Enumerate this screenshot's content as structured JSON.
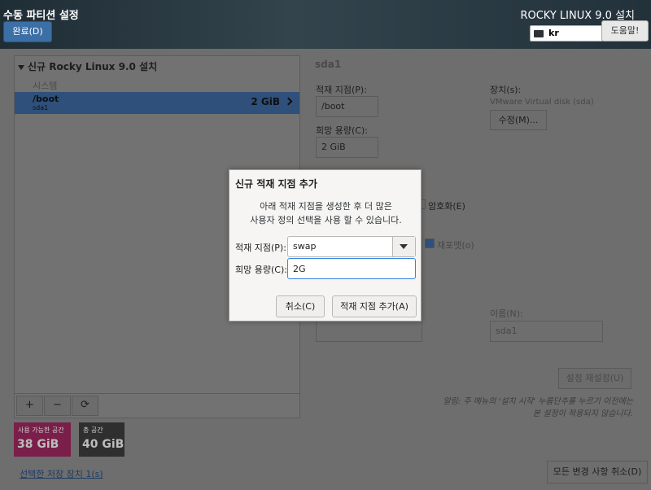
{
  "header": {
    "title": "수동 파티션 설정",
    "done_label": "완료(D)",
    "product_title": "ROCKY LINUX 9.0 설치",
    "keyboard_layout": "kr",
    "help_label": "도움말!"
  },
  "left_panel": {
    "install_title": "신규 Rocky Linux 9.0 설치",
    "system_label": "시스템",
    "selected_mount": {
      "name": "/boot",
      "device": "sda1",
      "size": "2 GiB"
    },
    "toolbar": {
      "add": "+",
      "remove": "−",
      "refresh": "⟳"
    }
  },
  "space": {
    "available_label": "사용 가능한 공간",
    "available_value": "38 GiB",
    "total_label": "총 공간",
    "total_value": "40 GiB"
  },
  "storage_link": "선택한 저장 장치 1(s)",
  "details": {
    "title": "sda1",
    "mount_point_label": "적재 지점(P):",
    "mount_point_value": "/boot",
    "capacity_label": "희망 용량(C):",
    "capacity_value": "2 GiB",
    "device_label": "장치(s):",
    "device_value": "VMware Virtual disk (sda)",
    "modify_label": "수정(M)...",
    "encrypt_label": "암호화(E)",
    "reformat_label": "재포맷(o)",
    "name_label": "이름(N):",
    "name_value": "sda1",
    "reset_label": "설정 재설정(U)",
    "note_line1": "알림: 주 메뉴의 '설치 시작' 누름단추를 누르기 이전에는",
    "note_line2": "본 설정이 적용되지 않습니다.",
    "discard_label": "모든 변경 사항 취소(D)"
  },
  "dialog": {
    "title": "신규 적재 지점 추가",
    "desc_line1": "아래 적재 지점을 생성한 후 더 많은",
    "desc_line2": "사용자 정의 선택을 사용 할 수 있습니다.",
    "mount_label": "적재 지점(P):",
    "mount_value": "swap",
    "capacity_label": "희망 용량(C):",
    "capacity_value": "2G",
    "cancel_label": "취소(C)",
    "add_label": "적재 지점 추가(A)"
  },
  "colors": {
    "accent": "#3584e4",
    "selected_row": "#2f507a",
    "available_space": "#7a1f4a",
    "total_space": "#2f2f2f"
  }
}
